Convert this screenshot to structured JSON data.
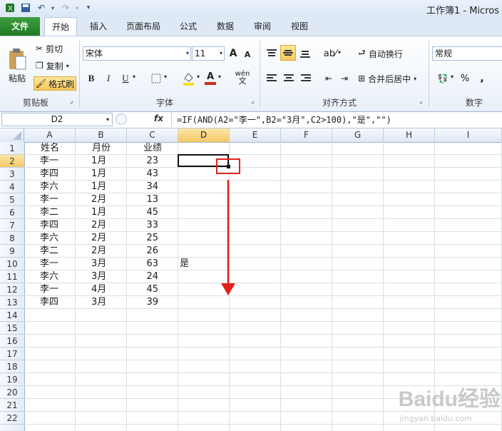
{
  "app": {
    "title": "工作簿1 - Micros",
    "tabs": [
      "文件",
      "开始",
      "插入",
      "页面布局",
      "公式",
      "数据",
      "审阅",
      "视图"
    ]
  },
  "ribbon": {
    "clipboard": {
      "paste": "粘贴",
      "cut": "剪切",
      "copy": "复制",
      "format_painter": "格式刷",
      "label": "剪贴板"
    },
    "font": {
      "name": "宋体",
      "size": "11",
      "bold": "B",
      "italic": "I",
      "underline": "U",
      "grow": "A",
      "shrink": "A",
      "font_color": "A",
      "phonetic": "wén",
      "label": "字体"
    },
    "alignment": {
      "wrap": "自动换行",
      "merge": "合并后居中",
      "label": "对齐方式"
    },
    "number": {
      "format": "常规",
      "percent": "%",
      "comma": ",",
      "label": "数字"
    }
  },
  "formula_bar": {
    "name_box": "D2",
    "fx": "fx",
    "formula": "=IF(AND(A2=\"李一\",B2=\"3月\",C2>100),\"是\",\"\")"
  },
  "sheet": {
    "columns": [
      "A",
      "B",
      "C",
      "D",
      "E",
      "F",
      "G",
      "H",
      "I"
    ],
    "rows": [
      "1",
      "2",
      "3",
      "4",
      "5",
      "6",
      "7",
      "8",
      "9",
      "10",
      "11",
      "12",
      "13",
      "14",
      "15",
      "16",
      "17",
      "18",
      "19",
      "20",
      "21",
      "22"
    ],
    "selected_col": "D",
    "selected_row": "2",
    "header": [
      "姓名",
      "月份",
      "业绩"
    ],
    "data": [
      [
        "李一",
        "1月",
        "23"
      ],
      [
        "李四",
        "1月",
        "43"
      ],
      [
        "李六",
        "1月",
        "34"
      ],
      [
        "李一",
        "2月",
        "13"
      ],
      [
        "李二",
        "1月",
        "45"
      ],
      [
        "李四",
        "2月",
        "33"
      ],
      [
        "李六",
        "2月",
        "25"
      ],
      [
        "李二",
        "2月",
        "26"
      ],
      [
        "李一",
        "3月",
        "63"
      ],
      [
        "李六",
        "3月",
        "24"
      ],
      [
        "李一",
        "4月",
        "45"
      ],
      [
        "李四",
        "3月",
        "39"
      ]
    ],
    "d10_value": "是"
  },
  "annotation": {
    "color": "#e2211c"
  },
  "watermark": {
    "brand": "Baidu经验",
    "url": "jingyan.baidu.com"
  }
}
